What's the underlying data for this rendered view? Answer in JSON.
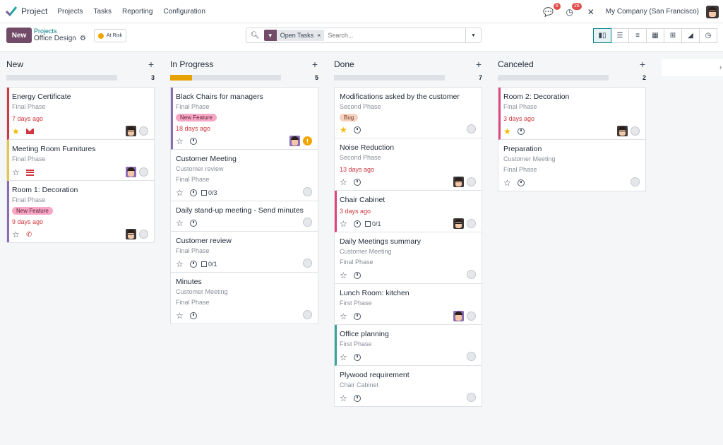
{
  "nav": {
    "app_name": "Project",
    "menu": [
      "Projects",
      "Tasks",
      "Reporting",
      "Configuration"
    ],
    "chat_badge": "6",
    "activity_badge": "26",
    "company": "My Company (San Francisco)"
  },
  "control": {
    "new_label": "New",
    "breadcrumb_parent": "Projects",
    "breadcrumb_current": "Office Design",
    "status_label": "At Risk",
    "facet_label": "Open Tasks",
    "search_placeholder": "Search..."
  },
  "columns": [
    {
      "title": "New",
      "count": "3",
      "progress": 0,
      "cards": [
        {
          "title": "Energy Certificate",
          "sub": [
            "Final Phase"
          ],
          "date": "7 days ago",
          "starred": true,
          "activity": "mail",
          "avatar": "dark",
          "border": "#d0383f"
        },
        {
          "title": "Meeting Room Furnitures",
          "sub": [
            "Final Phase"
          ],
          "starred": false,
          "activity": "list",
          "avatar": "purple",
          "border": "#e8c547"
        },
        {
          "title": "Room 1: Decoration",
          "sub": [
            "Final Phase"
          ],
          "tag": "New Feature",
          "date": "9 days ago",
          "starred": false,
          "activity": "phone",
          "avatar": "dark",
          "border": "#8b6db5"
        }
      ]
    },
    {
      "title": "In Progress",
      "count": "5",
      "progress": 0.2,
      "cards": [
        {
          "title": "Black Chairs for managers",
          "sub": [
            "Final Phase"
          ],
          "tag": "New Feature",
          "date": "18 days ago",
          "starred": false,
          "activity": "clock",
          "avatar": "purple",
          "state": "warn",
          "border": "#8b6db5"
        },
        {
          "title": "Customer Meeting",
          "sub": [
            "Customer review",
            "Final Phase"
          ],
          "starred": false,
          "activity": "clock",
          "checks": "0/3"
        },
        {
          "title": "Daily stand-up meeting - Send minutes",
          "sub": [],
          "starred": false,
          "activity": "clock"
        },
        {
          "title": "Customer review",
          "sub": [
            "Final Phase"
          ],
          "starred": false,
          "activity": "clock",
          "checks": "0/1"
        },
        {
          "title": "Minutes",
          "sub": [
            "Customer Meeting",
            "Final Phase"
          ],
          "starred": false,
          "activity": "clock"
        }
      ]
    },
    {
      "title": "Done",
      "count": "7",
      "progress": 0,
      "cards": [
        {
          "title": "Modifications asked by the customer",
          "sub": [
            "Second Phase"
          ],
          "bug": "Bug",
          "starred": true,
          "activity": "clock"
        },
        {
          "title": "Noise Reduction",
          "sub": [
            "Second Phase"
          ],
          "date": "13 days ago",
          "starred": false,
          "activity": "clock",
          "avatar": "dark"
        },
        {
          "title": "Chair Cabinet",
          "sub": [],
          "date": "3 days ago",
          "starred": false,
          "activity": "clock",
          "checks": "0/1",
          "avatar": "dark",
          "border": "#e0457b"
        },
        {
          "title": "Daily Meetings summary",
          "sub": [
            "Customer Meeting",
            "Final Phase"
          ],
          "starred": false,
          "activity": "clock"
        },
        {
          "title": "Lunch Room: kitchen",
          "sub": [
            "First Phase"
          ],
          "starred": false,
          "activity": "clock",
          "avatar": "purple"
        },
        {
          "title": "Office planning",
          "sub": [
            "First Phase"
          ],
          "starred": false,
          "activity": "clock",
          "border": "#3aa39b"
        },
        {
          "title": "Plywood requirement",
          "sub": [
            "Chair Cabinet"
          ],
          "starred": false,
          "activity": "clock"
        }
      ]
    },
    {
      "title": "Canceled",
      "count": "2",
      "progress": 0,
      "cards": [
        {
          "title": "Room 2: Decoration",
          "sub": [
            "Final Phase"
          ],
          "date": "3 days ago",
          "starred": true,
          "activity": "clock",
          "avatar": "dark",
          "border": "#e0457b"
        },
        {
          "title": "Preparation",
          "sub": [
            "Customer Meeting",
            "Final Phase"
          ],
          "starred": false,
          "activity": "clock"
        }
      ]
    }
  ]
}
